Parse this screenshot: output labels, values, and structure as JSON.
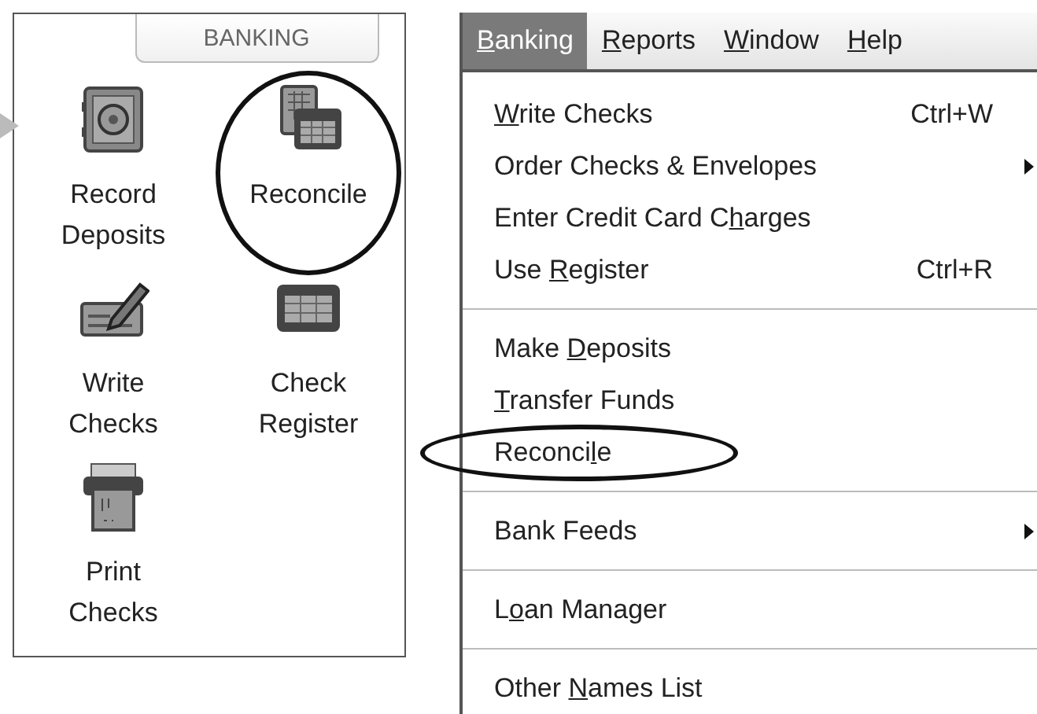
{
  "banking_panel": {
    "tab": "BANKING",
    "tiles": [
      {
        "kind": "safe",
        "label": "Record Deposits",
        "circled": false
      },
      {
        "kind": "reconcile",
        "label": "Reconcile",
        "circled": true
      },
      {
        "kind": "write",
        "label": "Write Checks",
        "circled": false
      },
      {
        "kind": "register",
        "label": "Check Register",
        "circled": false
      },
      {
        "kind": "print",
        "label": "Print Checks",
        "circled": false
      }
    ]
  },
  "menu_bar": [
    {
      "access_key": "B",
      "after": "anking",
      "selected": true
    },
    {
      "access_key": "R",
      "after": "eports",
      "selected": false
    },
    {
      "access_key": "W",
      "after": "indow",
      "selected": false
    },
    {
      "access_key": "H",
      "after": "elp",
      "selected": false
    }
  ],
  "banking_menu": [
    {
      "kind": "item",
      "access_key": "W",
      "after": "rite Checks",
      "shortcut": "Ctrl+W",
      "submenu": false,
      "circled": false
    },
    {
      "kind": "item",
      "before": "Order Checks & Envelopes",
      "submenu": true,
      "circled": false
    },
    {
      "kind": "item",
      "before": "Enter Credit Card C",
      "access_key": "h",
      "after": "arges",
      "submenu": false,
      "circled": false
    },
    {
      "kind": "item",
      "before": "Use ",
      "access_key": "R",
      "after": "egister",
      "shortcut": "Ctrl+R",
      "submenu": false,
      "circled": false
    },
    {
      "kind": "separator"
    },
    {
      "kind": "item",
      "before": "Make ",
      "access_key": "D",
      "after": "eposits",
      "submenu": false,
      "circled": false
    },
    {
      "kind": "item",
      "access_key": "T",
      "after": "ransfer Funds",
      "submenu": false,
      "circled": false
    },
    {
      "kind": "item",
      "before": "Reconci",
      "access_key": "l",
      "after": "e",
      "submenu": false,
      "circled": true
    },
    {
      "kind": "separator"
    },
    {
      "kind": "item",
      "before": "Bank Feeds",
      "submenu": true,
      "circled": false
    },
    {
      "kind": "separator"
    },
    {
      "kind": "item",
      "before": "L",
      "access_key": "o",
      "after": "an Manager",
      "submenu": false,
      "circled": false
    },
    {
      "kind": "separator"
    },
    {
      "kind": "item",
      "before": "Other ",
      "access_key": "N",
      "after": "ames List",
      "submenu": false,
      "circled": false
    }
  ]
}
